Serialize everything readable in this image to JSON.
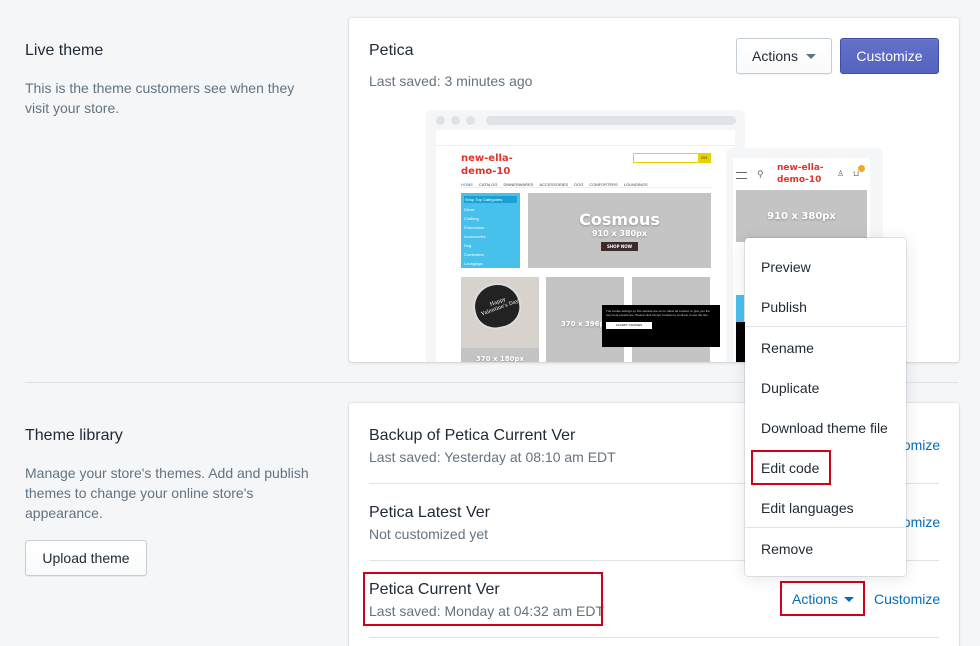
{
  "live": {
    "title": "Live theme",
    "desc": "This is the theme customers see when they visit your store.",
    "theme_name": "Petica",
    "last_saved": "Last saved: 3 minutes ago",
    "actions_label": "Actions",
    "customize_label": "Customize"
  },
  "preview": {
    "store_name_line1": "new-ella-",
    "store_name_line2": "demo-10",
    "hero_title": "Cosmous",
    "hero_size": "910 x 380px",
    "shop_now": "SHOP NOW",
    "top_categories": "Shop Top Categories",
    "categories": [
      "Decor",
      "Clothing",
      "Dinnerware",
      "Accessories",
      "Dog",
      "Comforters",
      "Loungings"
    ],
    "nav": [
      "HOME",
      "CATALOG",
      "DINNERWARES",
      "ACCESSORIES",
      "DOG",
      "COMFORTERS",
      "LOUNGINGS"
    ],
    "small_size": "370 x 396px",
    "card_size": "370 x 180px",
    "heart_text": "Happy Valentine's Day",
    "mobile_hero_size": "910 x 380px",
    "cookie_text": "The cookie settings on this website are set to 'allow all cookies' to give you the very best experience. Please click Accept Cookies to continue to use the site.",
    "accept_cookies": "ACCEPT COOKIES",
    "search_btn": "GO"
  },
  "library": {
    "title": "Theme library",
    "desc": "Manage your store's themes. Add and publish themes to change your online store's appearance.",
    "upload_label": "Upload theme",
    "themes": [
      {
        "name": "Backup of Petica Current Ver",
        "meta": "Last saved: Yesterday at 08:10 am EDT",
        "customize": "Customize"
      },
      {
        "name": "Petica Latest Ver",
        "meta": "Not customized yet",
        "customize": "Customize"
      },
      {
        "name": "Petica Current Ver",
        "meta": "Last saved: Monday at 04:32 am EDT",
        "customize": "Customize",
        "actions": "Actions"
      }
    ]
  },
  "menu": {
    "items": [
      "Preview",
      "Publish",
      "Rename",
      "Duplicate",
      "Download theme file",
      "Edit code",
      "Edit languages",
      "Remove"
    ]
  },
  "colors": {
    "primary": "#5c6ac4",
    "link": "#006fbb",
    "highlight": "#d0021b",
    "preview_blue": "#47c1ec",
    "logo_red": "#e0332b"
  }
}
